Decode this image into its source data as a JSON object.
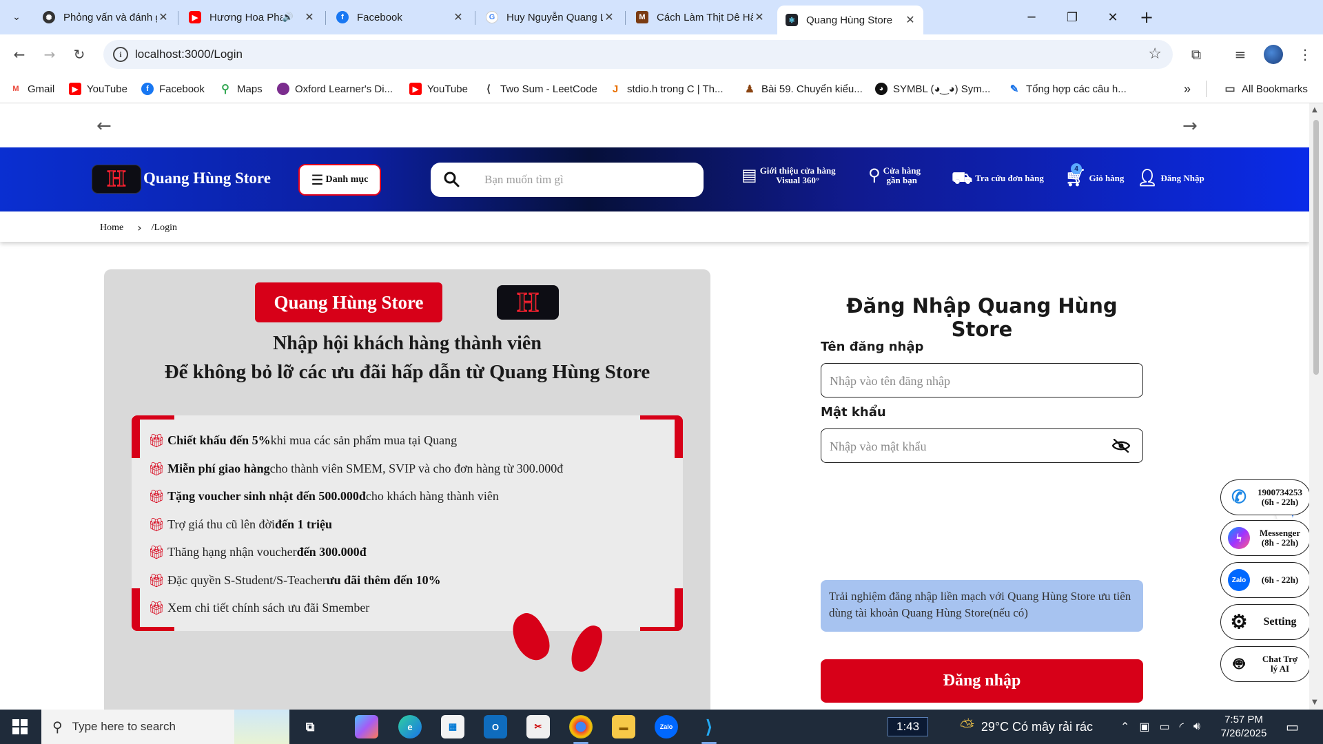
{
  "browser": {
    "tabs": [
      {
        "title": "Phỏng vấn và đánh giá CV",
        "icon": "openai-icon",
        "color": "#333333"
      },
      {
        "title": "Hương Hoa Phai Tàn (T",
        "icon": "youtube-icon",
        "color": "#ff0000"
      },
      {
        "title": "Facebook",
        "icon": "facebook-icon",
        "color": "#1877f2"
      },
      {
        "title": "Huy Nguyễn Quang Lập trì",
        "icon": "google-icon",
        "color": "#4285f4"
      },
      {
        "title": "Cách Làm Thịt Dê Hấp Lá T",
        "icon": "recipe-icon",
        "color": "#7a3b12"
      },
      {
        "title": "Quang Hùng Store",
        "icon": "react-icon",
        "color": "#222222"
      }
    ],
    "url": "localhost:3000/Login",
    "bookmarks": [
      {
        "label": "Gmail",
        "icon": "gmail-icon",
        "color": "#ea4335"
      },
      {
        "label": "YouTube",
        "icon": "youtube-icon",
        "color": "#ff0000"
      },
      {
        "label": "Facebook",
        "icon": "facebook-icon",
        "color": "#1877f2"
      },
      {
        "label": "Maps",
        "icon": "maps-icon",
        "color": "#34a853"
      },
      {
        "label": "Oxford Learner's Di...",
        "icon": "oxford-icon",
        "color": "#7b2d8e"
      },
      {
        "label": "YouTube",
        "icon": "youtube-icon",
        "color": "#ff0000"
      },
      {
        "label": "Two Sum - LeetCode",
        "icon": "leetcode-icon",
        "color": "#333333"
      },
      {
        "label": "stdio.h trong C | Th...",
        "icon": "java-icon",
        "color": "#e76f00"
      },
      {
        "label": "Bài 59. Chuyển kiểu...",
        "icon": "person-icon",
        "color": "#8b4513"
      },
      {
        "label": "SYMBL (◕‿◕) Sym...",
        "icon": "symbl-icon",
        "color": "#111111"
      },
      {
        "label": "Tổng hợp các câu h...",
        "icon": "pencil-icon",
        "color": "#1a73e8"
      }
    ],
    "all_bookmarks": "All Bookmarks"
  },
  "header": {
    "store_name": "Quang Hùng Store",
    "logo_letter": "H",
    "category_label": "Danh mục",
    "search_placeholder": "Bạn muốn tìm gì",
    "intro_line1": "Giới thiệu cửa hàng",
    "intro_line2": "Visual 360°",
    "nearby_line1": "Cửa hàng",
    "nearby_line2": "gần bạn",
    "track_order": "Tra cứu đơn hàng",
    "cart": "Giỏ hàng",
    "cart_count": "4",
    "login": "Đăng Nhập"
  },
  "breadcrumb": {
    "home": "Home",
    "current": "/Login"
  },
  "promo": {
    "brand": "Quang Hùng Store",
    "heading1": "Nhập hội khách hàng thành viên",
    "heading2": "Để không bỏ lỡ các ưu đãi hấp dẫn từ Quang Hùng Store",
    "perks": [
      {
        "bold": "Chiết khấu đến 5%",
        "rest": " khi mua các sản phẩm mua tại Quang"
      },
      {
        "bold": "Miễn phí giao hàng",
        "rest": " cho thành viên SMEM, SVIP và cho đơn hàng từ 300.000đ"
      },
      {
        "bold": "Tặng voucher sinh nhật đến 500.000đ",
        "rest": " cho khách hàng thành viên"
      },
      {
        "pre": "Trợ giá thu cũ lên đời ",
        "bold": "đến 1 triệu"
      },
      {
        "pre": "Thăng hạng nhận voucher",
        "bold": "đến 300.000đ"
      },
      {
        "pre": "Đặc quyền S-Student/S-Teacher ",
        "bold": "ưu đãi thêm đến 10%"
      },
      {
        "pre": "Xem chi tiết chính sách ưu đãi Smember"
      }
    ]
  },
  "login": {
    "title": "Đăng Nhập Quang Hùng Store",
    "username_label": "Tên đăng nhập",
    "username_placeholder": "Nhập vào tên đăng nhập",
    "password_label": "Mật khẩu",
    "password_placeholder": "Nhập vào mật khẩu",
    "info_text": "Trải nghiệm đăng nhập liền mạch với Quang Hùng Store ưu tiên dùng tài khoản Quang Hùng Store(nếu có)",
    "submit": "Đăng nhập"
  },
  "contacts": [
    {
      "line1": "1900734253",
      "line2": "(6h - 22h)",
      "icon": "phone-icon",
      "color": "#1e88e5"
    },
    {
      "line1": "Messenger",
      "line2": "(8h - 22h)",
      "icon": "messenger-icon",
      "color": "#a033ff"
    },
    {
      "line1": "(6h - 22h)",
      "line2": "",
      "icon": "zalo-icon",
      "color": "#0068ff"
    },
    {
      "line1": "Setting",
      "line2": "",
      "icon": "gear-icon",
      "color": "#111111"
    },
    {
      "line1": "Chat Trợ",
      "line2": "lý AI",
      "icon": "robot-icon",
      "color": "#111111"
    }
  ],
  "taskbar": {
    "search_placeholder": "Type here to search",
    "clock_badge": "1:43",
    "weather": "29°C  Có mây rải rác",
    "time": "7:57 PM",
    "date": "7/26/2025"
  },
  "colors": {
    "brand_red": "#d70018",
    "header_blue": "#0a2be8",
    "info_blue": "#a7c3f0"
  }
}
